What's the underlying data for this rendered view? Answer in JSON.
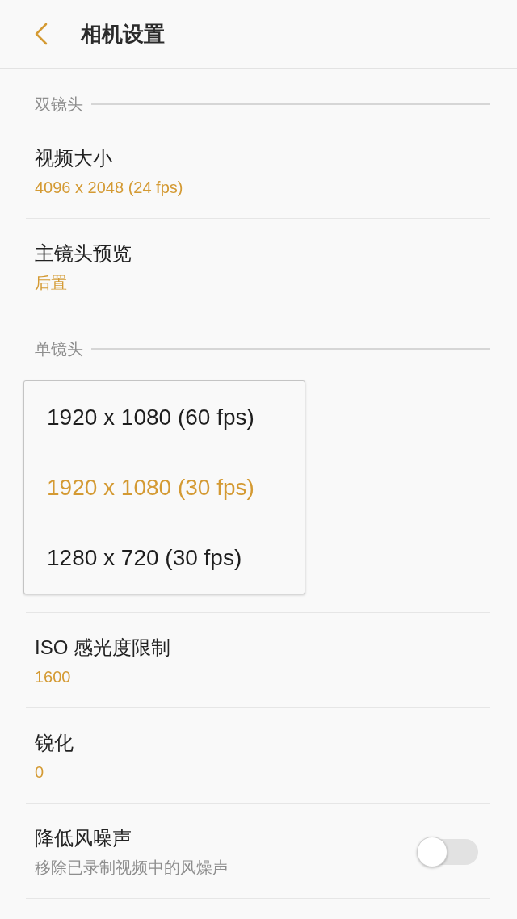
{
  "header": {
    "title": "相机设置"
  },
  "sections": [
    {
      "title": "双镜头",
      "items": [
        {
          "kind": "value",
          "title": "视频大小",
          "value": "4096 x 2048 (24 fps)"
        },
        {
          "kind": "value",
          "title": "主镜头预览",
          "value": "后置"
        }
      ]
    },
    {
      "title": "单镜头",
      "dropdown": {
        "options": [
          {
            "label": "1920 x 1080 (60 fps)",
            "selected": false
          },
          {
            "label": "1920 x 1080 (30 fps)",
            "selected": true
          },
          {
            "label": "1280 x 720 (30 fps)",
            "selected": false
          }
        ]
      },
      "items": [
        {
          "kind": "value",
          "title": "ISO 感光度限制",
          "value": "1600"
        },
        {
          "kind": "value",
          "title": "锐化",
          "value": "0"
        },
        {
          "kind": "switch",
          "title": "降低风噪声",
          "description": "移除已录制视频中的风燥声",
          "on": false
        }
      ]
    }
  ]
}
